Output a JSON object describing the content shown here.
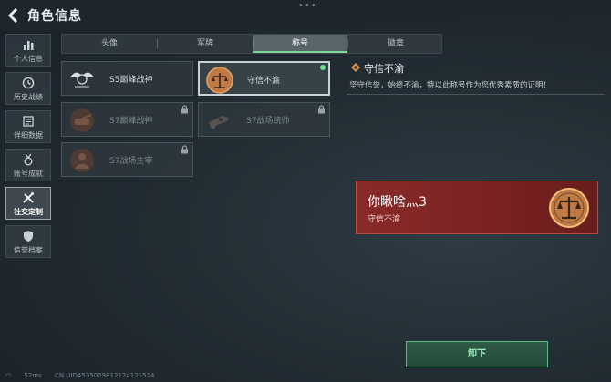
{
  "header": {
    "title": "角色信息"
  },
  "sidebar": {
    "items": [
      {
        "label": "个人信息",
        "icon": "bar-chart-icon"
      },
      {
        "label": "历史战绩",
        "icon": "clock-icon"
      },
      {
        "label": "详细数据",
        "icon": "document-icon"
      },
      {
        "label": "账号成就",
        "icon": "medal-icon"
      },
      {
        "label": "社交定制",
        "icon": "tools-icon",
        "active": true
      },
      {
        "label": "信誉档案",
        "icon": "shield-icon"
      }
    ]
  },
  "tabs": [
    {
      "label": "头像"
    },
    {
      "label": "军牌"
    },
    {
      "label": "称号",
      "active": true
    },
    {
      "label": "徽章"
    }
  ],
  "titles": [
    {
      "name": "S5巅峰战神",
      "locked": false
    },
    {
      "name": "守信不渝",
      "locked": false,
      "selected": true,
      "equipped": true
    },
    {
      "name": "S7巅峰战神",
      "locked": true
    },
    {
      "name": "S7战场统帅",
      "locked": true
    },
    {
      "name": "S7战场主宰",
      "locked": true
    }
  ],
  "detail": {
    "title": "守信不渝",
    "description": "坚守信誉，始终不渝，特以此称号作为您优秀素质的证明！"
  },
  "preview": {
    "player_name": "你瞅啥灬3",
    "title": "守信不渝"
  },
  "actions": {
    "unequip_label": "卸下"
  },
  "status": {
    "ping": "52ms",
    "uid": "CN UID4535029812124121514"
  },
  "colors": {
    "accent_green": "#6ee08a",
    "preview_red": "#8a2a2a",
    "emblem_bronze": "#c07a45"
  }
}
